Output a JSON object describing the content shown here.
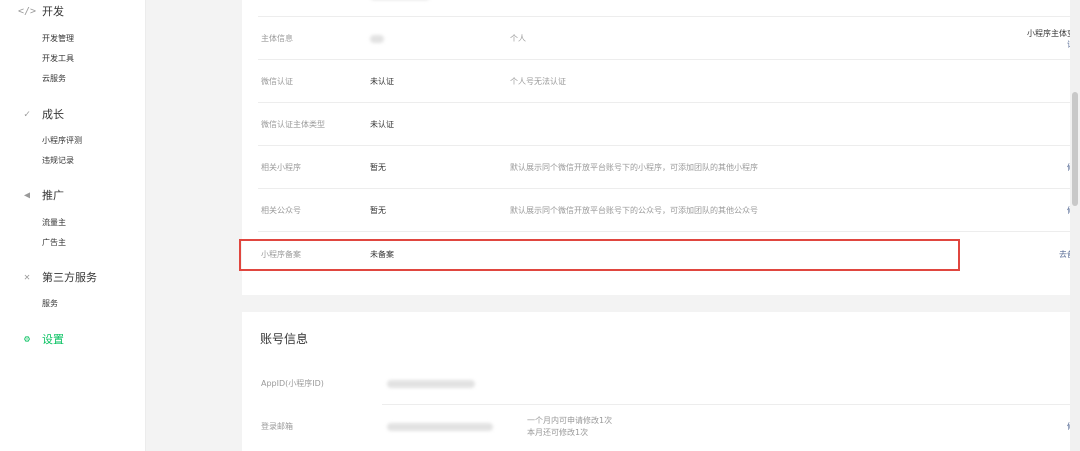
{
  "sidebar": {
    "groups": [
      {
        "icon": "code-icon",
        "glyph": "</>",
        "title": "开发",
        "items": [
          "开发管理",
          "开发工具",
          "云服务"
        ]
      },
      {
        "icon": "leaf-icon",
        "glyph": "✓",
        "title": "成长",
        "items": [
          "小程序评测",
          "违规记录"
        ]
      },
      {
        "icon": "megaphone-icon",
        "glyph": "◀",
        "title": "推广",
        "items": [
          "流量主",
          "广告主"
        ]
      },
      {
        "icon": "third-party-icon",
        "glyph": "✕",
        "title": "第三方服务",
        "items": [
          "服务"
        ]
      },
      {
        "icon": "settings-icon",
        "glyph": "⚙",
        "title": "设置",
        "items": []
      }
    ]
  },
  "basic_info": {
    "rows": [
      {
        "label": "主体信息",
        "value": "",
        "desc": "个人",
        "action_line1": "小程序主体变更",
        "action_line2": "详情"
      },
      {
        "label": "微信认证",
        "value": "未认证",
        "desc": "个人号无法认证",
        "action": ""
      },
      {
        "label": "微信认证主体类型",
        "value": "未认证",
        "desc": "",
        "action": ""
      },
      {
        "label": "相关小程序",
        "value": "暂无",
        "desc": "默认展示同个微信开放平台账号下的小程序，可添加团队的其他小程序",
        "action": "修改"
      },
      {
        "label": "相关公众号",
        "value": "暂无",
        "desc": "默认展示同个微信开放平台账号下的公众号，可添加团队的其他公众号",
        "action": "修改"
      },
      {
        "label": "小程序备案",
        "value": "未备案",
        "desc": "",
        "action": "去备案"
      }
    ]
  },
  "account_info": {
    "title": "账号信息",
    "rows": [
      {
        "label": "AppID(小程序ID)"
      },
      {
        "label": "登录邮箱",
        "note_line1": "一个月内可申请修改1次",
        "note_line2": "本月还可修改1次",
        "action": "修改"
      }
    ]
  },
  "colors": {
    "accent": "#07c160",
    "link": "#576b95",
    "highlight": "#e0463f"
  }
}
